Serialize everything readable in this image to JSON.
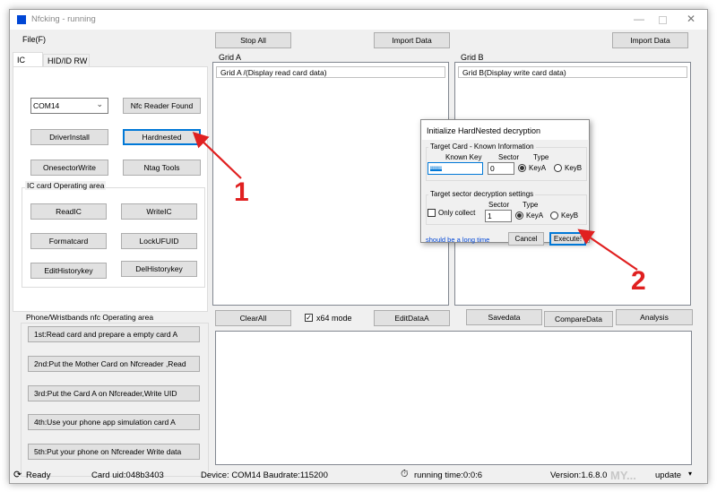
{
  "window": {
    "title": "Nfcking - running",
    "accent": "#0078d7"
  },
  "menu": {
    "file": "File(F)"
  },
  "toolbar": {
    "stop_all": "Stop All",
    "import_data_a": "Import Data",
    "import_data_b": "Import Data"
  },
  "tabs": [
    "IC",
    "HID/ID RW"
  ],
  "reader": {
    "port": "COM14",
    "found_label": "Nfc Reader Found",
    "driver_install": "DriverInstall",
    "hardnested": "Hardnested",
    "onesector_write": "OnesectorWrite",
    "ntag_tools": "Ntag Tools"
  },
  "ic_area": {
    "title": "IC card Operating area",
    "read_ic": "ReadIC",
    "write_ic": "WriteIC",
    "format_card": "Formatcard",
    "lock_ufuid": "LockUFUID",
    "edit_history_key": "EditHistorykey",
    "del_history_key": "DelHistorykey"
  },
  "phone_area": {
    "title": "Phone/Wristbands nfc Operating area",
    "steps": [
      "1st:Read card and prepare a empty card A",
      "2nd:Put the Mother Card on Nfcreader ,Read",
      "3rd:Put the Card A on Nfcreader,Write UID",
      "4th:Use your phone app simulation card A",
      "5th:Put your phone on Nfcreader Write data"
    ]
  },
  "grid_a": {
    "title": "Grid A",
    "header": "Grid A /(Display read card data)"
  },
  "grid_b": {
    "title": "Grid B",
    "header": "Grid B(Display write card data)"
  },
  "actions": {
    "clear_all": "ClearAll",
    "x64_mode": "x64 mode",
    "edit_data_a": "EditDataA",
    "save_data": "Savedata",
    "compare_data": "CompareData",
    "analysis": "Analysis"
  },
  "dialog": {
    "title": "Initialize HardNested decryption",
    "target_group": "Target Card - Known Information",
    "known_key_label": "Known Key",
    "sector_label": "Sector",
    "type_label": "Type",
    "known_key_value": "ffffffffffff",
    "sector_value": "0",
    "key_a": "KeyA",
    "key_b": "KeyB",
    "settings_group": "Target sector decryption settings",
    "only_collect": "Only collect",
    "target_sector_label": "Sector",
    "target_type_label": "Type",
    "target_sector_value": "1",
    "hint": "should be a long time",
    "cancel": "Cancel",
    "execute": "Execute!"
  },
  "annotations": {
    "one": "1",
    "two": "2",
    "color": "#e02020"
  },
  "status": {
    "ready": "Ready",
    "card_uid": "Card uid:048b3403",
    "device": "Device: COM14  Baudrate:115200",
    "running_time": "running time:0:0:6",
    "version": "Version:1.6.8.0",
    "update": "update",
    "watermark": "MY..."
  }
}
